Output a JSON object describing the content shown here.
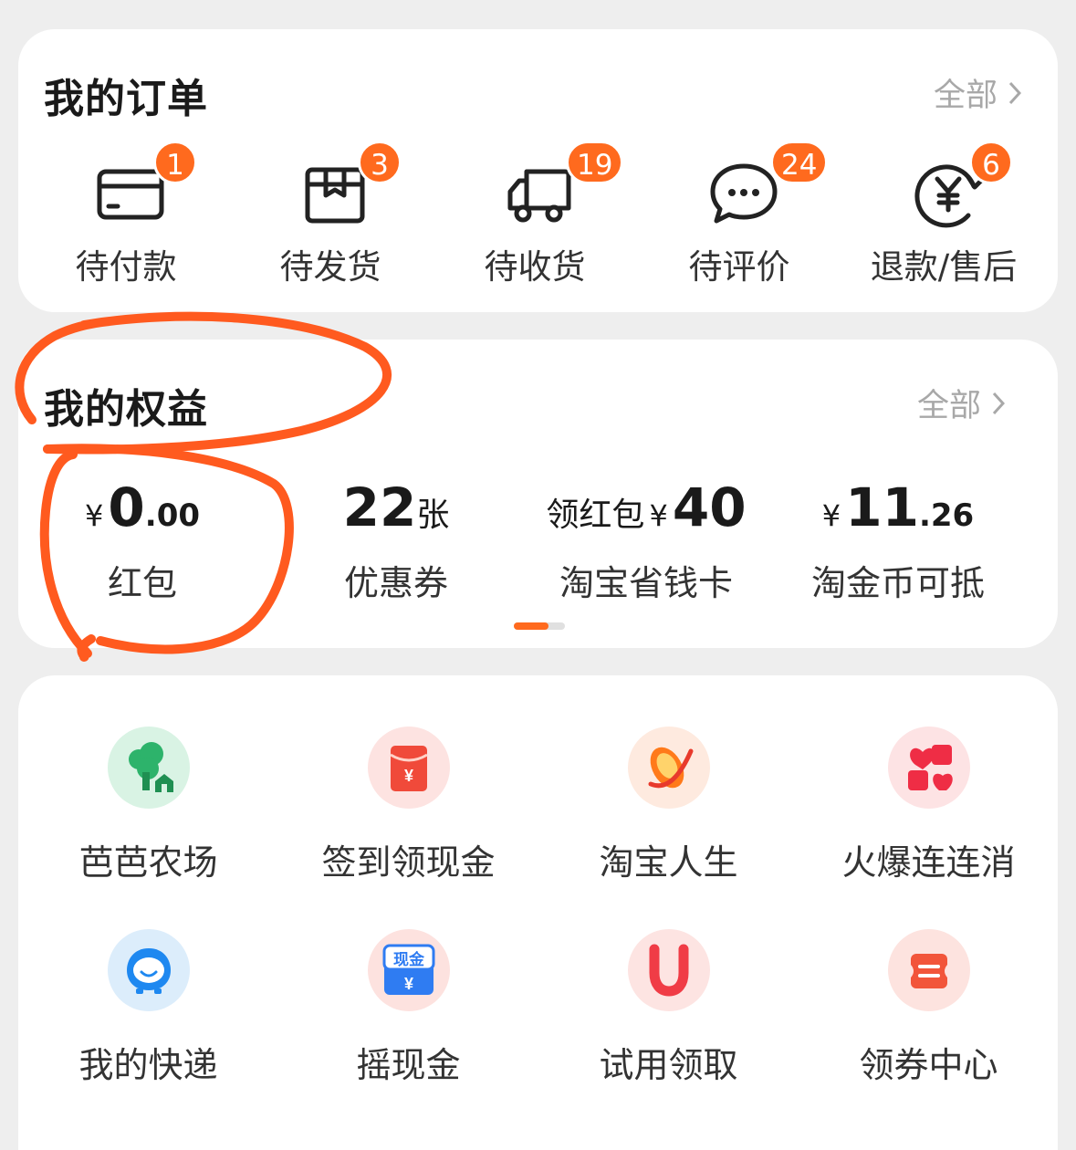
{
  "orders": {
    "title": "我的订单",
    "more": "全部",
    "items": [
      {
        "label": "待付款",
        "badge": "1",
        "icon": "wallet-card-icon"
      },
      {
        "label": "待发货",
        "badge": "3",
        "icon": "package-box-icon"
      },
      {
        "label": "待收货",
        "badge": "19",
        "icon": "delivery-truck-icon"
      },
      {
        "label": "待评价",
        "badge": "24",
        "icon": "chat-bubble-icon"
      },
      {
        "label": "退款/售后",
        "badge": "6",
        "icon": "yen-refund-icon"
      }
    ]
  },
  "benefits": {
    "title": "我的权益",
    "more": "全部",
    "items": [
      {
        "prefix": "¥",
        "value_int": "0",
        "value_dec": ".00",
        "label": "红包"
      },
      {
        "value_int": "22",
        "unit": "张",
        "label": "优惠券"
      },
      {
        "prefix_text": "领红包",
        "prefix": "¥",
        "value_int": "40",
        "label": "淘宝省钱卡"
      },
      {
        "prefix": "¥",
        "value_int": "11",
        "value_dec": ".26",
        "label": "淘金币可抵"
      }
    ],
    "page_progress": 0.68
  },
  "tools": {
    "items": [
      {
        "label": "芭芭农场",
        "icon": "tree-farm-icon"
      },
      {
        "label": "签到领现金",
        "icon": "red-envelope-icon"
      },
      {
        "label": "淘宝人生",
        "icon": "taobao-life-icon"
      },
      {
        "label": "火爆连连消",
        "icon": "hearts-game-icon"
      },
      {
        "label": "我的快递",
        "icon": "courier-mascot-icon"
      },
      {
        "label": "摇现金",
        "icon": "cash-shake-icon"
      },
      {
        "label": "试用领取",
        "icon": "magnet-u-icon"
      },
      {
        "label": "领券中心",
        "icon": "coupon-center-icon"
      }
    ],
    "cash_icon_text": "现金",
    "cash_icon_yen": "¥",
    "envelope_icon_yen": "¥"
  },
  "colors": {
    "accent": "#ff6a1e",
    "annotation": "#ff5a1f",
    "background": "#eeeeee"
  }
}
